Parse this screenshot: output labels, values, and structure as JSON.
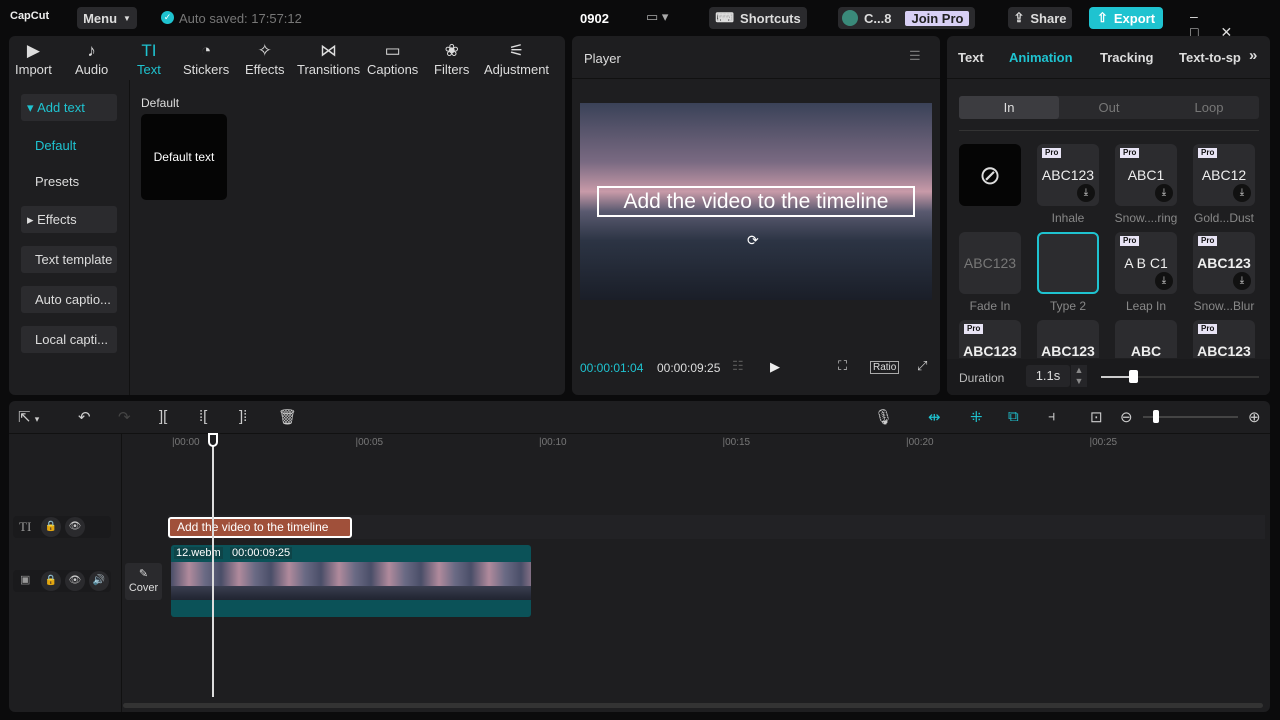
{
  "app": {
    "logo": "CapCut",
    "menu": "Menu",
    "autosave": "Auto saved: 17:57:12",
    "project": "0902",
    "shortcuts": "Shortcuts",
    "user": "C...8",
    "join_pro": "Join Pro",
    "share": "Share",
    "export": "Export",
    "accent": "#1fc3d0"
  },
  "toolbar": [
    {
      "label": "Import",
      "icon": "import-icon",
      "g": "▶"
    },
    {
      "label": "Audio",
      "icon": "audio-icon",
      "g": "♪"
    },
    {
      "label": "Text",
      "icon": "text-icon",
      "g": "TI"
    },
    {
      "label": "Stickers",
      "icon": "sticker-icon",
      "g": "◔"
    },
    {
      "label": "Effects",
      "icon": "effects-icon",
      "g": "✧"
    },
    {
      "label": "Transitions",
      "icon": "transitions-icon",
      "g": "⋈"
    },
    {
      "label": "Captions",
      "icon": "captions-icon",
      "g": "▭"
    },
    {
      "label": "Filters",
      "icon": "filters-icon",
      "g": "❀"
    },
    {
      "label": "Adjustment",
      "icon": "adjustment-icon",
      "g": "⚟"
    }
  ],
  "sidebar": {
    "add_text": "Add text",
    "default": "Default",
    "presets": "Presets",
    "effects": "Effects",
    "text_template": "Text template",
    "auto_captions": "Auto captio...",
    "local_captions": "Local capti..."
  },
  "content": {
    "section": "Default",
    "card": "Default text"
  },
  "player": {
    "title": "Player",
    "overlay_text": "Add the video to the timeline",
    "current": "00:00:01:04",
    "total": "00:00:09:25",
    "ratio": "Ratio"
  },
  "right": {
    "tabs": [
      "Text",
      "Animation",
      "Tracking",
      "Text-to-sp"
    ],
    "segments": [
      "In",
      "Out",
      "Loop"
    ],
    "cards": [
      {
        "label": "",
        "pro": false,
        "preview": "⃠"
      },
      {
        "label": "Inhale",
        "pro": true,
        "preview": "ABC123"
      },
      {
        "label": "Snow....ring",
        "pro": true,
        "preview": "ABC1"
      },
      {
        "label": "Gold...Dust",
        "pro": true,
        "preview": "ABC12"
      },
      {
        "label": "Fade In",
        "pro": false,
        "preview": "ABC123"
      },
      {
        "label": "Type 2",
        "pro": false,
        "preview": ""
      },
      {
        "label": "Leap In",
        "pro": true,
        "preview": "A B C1"
      },
      {
        "label": "Snow...Blur",
        "pro": true,
        "preview": "ABC123"
      },
      {
        "label": "",
        "pro": true,
        "preview": "ABC123"
      },
      {
        "label": "",
        "pro": false,
        "preview": "ABC123"
      },
      {
        "label": "",
        "pro": false,
        "preview": "ABC"
      },
      {
        "label": "",
        "pro": true,
        "preview": "ABC123"
      }
    ],
    "pro_badge": "Pro",
    "duration_label": "Duration",
    "duration_value": "1.1s",
    "duration_fraction": 0.2
  },
  "timeline": {
    "ticks": [
      "00:00",
      "00:05",
      "00:10",
      "00:15",
      "00:20",
      "00:25"
    ],
    "text_clip": "Add the video to the timeline",
    "video_name": "12.webm",
    "video_duration": "00:00:09:25",
    "cover": "Cover",
    "text_clip_color": "#a0503a",
    "video_clip_color": "#0b5258"
  }
}
